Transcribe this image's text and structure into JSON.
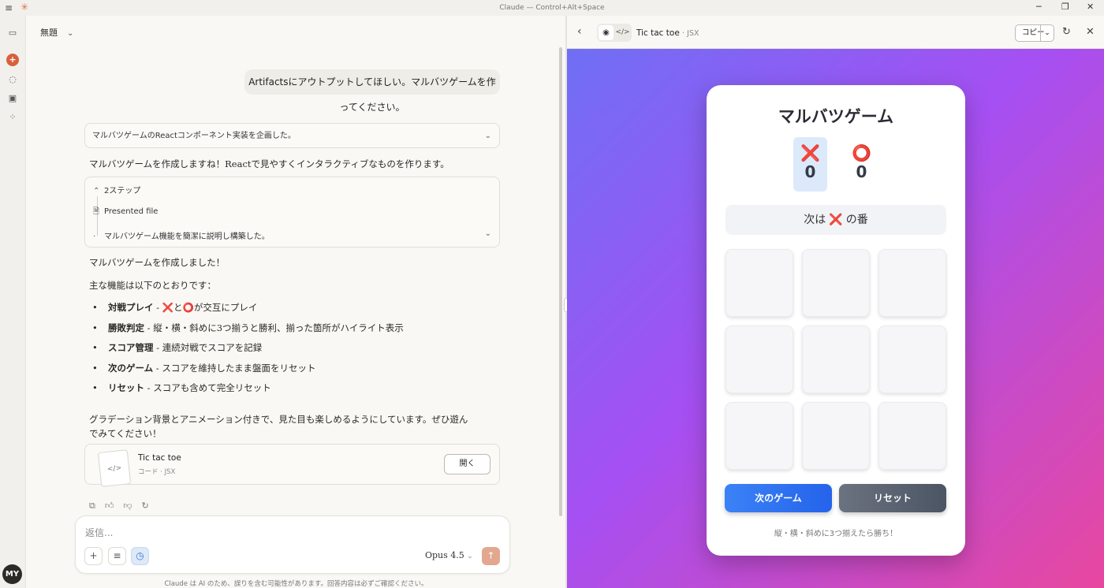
{
  "window": {
    "title": "Claude — Control+Alt+Space",
    "logo": "✳",
    "menu_icon": "≡",
    "min": "─",
    "restore": "❐",
    "close": "✕"
  },
  "rail": {
    "items": [
      "sidebar-toggle-icon",
      "new-chat-icon",
      "chats-icon",
      "projects-icon",
      "artifacts-icon"
    ],
    "avatar": "MY"
  },
  "chat": {
    "title": "無題",
    "user_message": "Artifactsにアウトプットしてほしい。マルバツゲームを作ってください。",
    "thinking_summary": "マルバツゲームのReactコンポーネント実装を企画した。",
    "intro": "マルバツゲームを作成しますね！Reactで見やすくインタラクティブなものを作ります。",
    "steps": {
      "label": "2ステップ",
      "file": "Presented file",
      "summary": "マルバツゲーム機能を簡潔に説明し構築した。"
    },
    "done": "マルバツゲームを作成しました！",
    "features_intro": "主な機能は以下のとおりです：",
    "features": [
      {
        "title": "対戦プレイ",
        "desc_pre": " - ",
        "x": "❌",
        "mid": "と",
        "o": "⭕",
        "desc": "が交互にプレイ"
      },
      {
        "title": "勝敗判定",
        "desc": " - 縦・横・斜めに3つ揃うと勝利、揃った箇所がハイライト表示"
      },
      {
        "title": "スコア管理",
        "desc": " - 連続対戦でスコアを記録"
      },
      {
        "title": "次のゲーム",
        "desc": " - スコアを維持したまま盤面をリセット"
      },
      {
        "title": "リセット",
        "desc": " - スコアも含めて完全リセット"
      }
    ],
    "closing_1": "グラデーション背景とアニメーション付きで、見た目も楽しめるようにしています。ぜひ遊ん",
    "closing_2": "でみてください！",
    "artifact_card": {
      "title": "Tic tac toe",
      "subtitle": "コード · JSX",
      "open": "開く",
      "thumb": "</>"
    },
    "composer": {
      "placeholder": "返信...",
      "model": "Opus 4.5"
    },
    "disclaimer": "Claude は AI のため、誤りを含む可能性があります。回答内容は必ずご確認ください。"
  },
  "artifact": {
    "title": "Tic tac toe",
    "subtitle": "· JSX",
    "copy": "コピー",
    "game": {
      "title": "マルバツゲーム",
      "x_symbol": "❌",
      "o_symbol": "⭕",
      "x_score": "0",
      "o_score": "0",
      "turn_pre": "次は",
      "turn_symbol": "❌",
      "turn_post": "の番",
      "next_button": "次のゲーム",
      "reset_button": "リセット",
      "hint": "縦・横・斜めに3つ揃えたら勝ち！"
    }
  }
}
